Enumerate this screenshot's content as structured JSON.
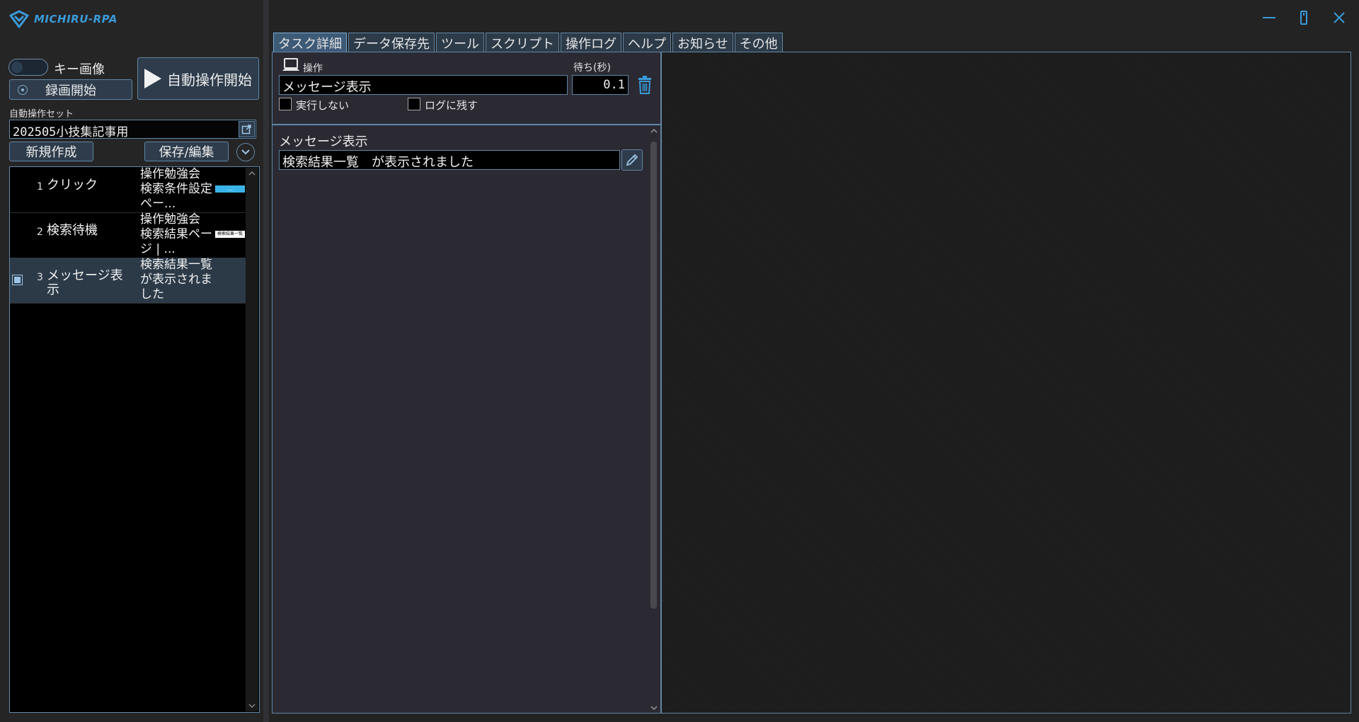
{
  "app": {
    "logo_text": "MICHIRU-RPA"
  },
  "controls": {
    "key_image_label": "キー画像",
    "record_label": "録画開始",
    "auto_start_label": "自動操作開始"
  },
  "set": {
    "label": "自動操作セット",
    "value": "202505小技集記事用",
    "new_label": "新規作成",
    "save_label": "保存/編集"
  },
  "tasks": [
    {
      "num": "1",
      "name": "クリック",
      "desc": "操作勉強会 検索条件設定ペー...",
      "thumb": "…"
    },
    {
      "num": "2",
      "name": "検索待機",
      "desc": "操作勉強会 検索結果ページ | ...",
      "thumb": "検索結果一覧"
    },
    {
      "num": "3",
      "name": "メッセージ表示",
      "desc": "検索結果一覧 が表示されました",
      "selected": true
    }
  ],
  "tabs": [
    "タスク詳細",
    "データ保存先",
    "ツール",
    "スクリプト",
    "操作ログ",
    "ヘルプ",
    "お知らせ",
    "その他"
  ],
  "detail": {
    "operation_label": "操作",
    "wait_label": "待ち(秒)",
    "operation_value": "メッセージ表示",
    "wait_value": "0.1",
    "no_run_label": "実行しない",
    "keep_log_label": "ログに残す",
    "message_title": "メッセージ表示",
    "message_value": "検索結果一覧　が表示されました"
  },
  "colors": {
    "accent": "#3a9ad8",
    "border": "#5f86a6",
    "panel": "#2b2a33"
  }
}
